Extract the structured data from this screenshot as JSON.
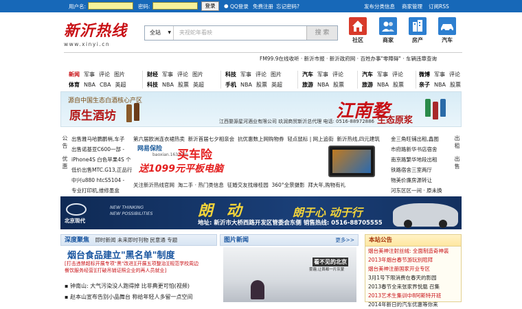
{
  "topbar": {
    "username_label": "用户名:",
    "password_label": "密码:",
    "login_button": "登录",
    "qq_login": "QQ登录",
    "register": "免费注册",
    "forgot": "忘记密码?",
    "right_links": [
      "发布分类信息",
      "商家管理",
      "订阅RSS"
    ]
  },
  "logo": {
    "title": "新沂热线",
    "url": "www.xinyi.cn"
  },
  "search": {
    "scope": "全站",
    "placeholder": "夹视蛇年看映",
    "button": "搜 索"
  },
  "categories": [
    {
      "label": "社区",
      "icon": "home-icon",
      "color": "#d83a2a"
    },
    {
      "label": "商家",
      "icon": "people-icon",
      "color": "#2d7fd0"
    },
    {
      "label": "房产",
      "icon": "building-icon",
      "color": "#2d7fd0"
    },
    {
      "label": "汽车",
      "icon": "car-icon",
      "color": "#2d7fd0"
    }
  ],
  "ticker": "FM99.9在线收听 · 新沂市报 · 新沂政府网 · 百姓办事\"零障碍\" · 车辆违章查询",
  "nav": [
    {
      "top": [
        "新闻",
        "军事",
        "评论",
        "图片"
      ],
      "bottom": [
        "体育",
        "NBA",
        "CBA",
        "英超"
      ]
    },
    {
      "top": [
        "财经",
        "军事",
        "评论",
        "图片"
      ],
      "bottom": [
        "科技",
        "NBA",
        "股票",
        "英超"
      ]
    },
    {
      "top": [
        "科技",
        "军事",
        "评论",
        "图片"
      ],
      "bottom": [
        "手机",
        "NBA",
        "股票",
        "英超"
      ]
    },
    {
      "top": [
        "汽车",
        "军事",
        "评论"
      ],
      "bottom": [
        "旅游",
        "NBA",
        "股票"
      ]
    },
    {
      "top": [
        "汽车",
        "军事",
        "评论"
      ],
      "bottom": [
        "旅游",
        "NBA",
        "股票"
      ]
    },
    {
      "top": [
        "微博",
        "军事",
        "评论"
      ],
      "bottom": [
        "亲子",
        "NBA",
        "股票"
      ]
    }
  ],
  "banner1": {
    "t1": "源自中国生态白酒核心产区",
    "t2": "原生酒坊",
    "t3": "江西婺源星河酒业有限公司 玖润商贸新沂总代理 电话: 0516-88972886",
    "t4": "江南婺",
    "t5": "生态原浆"
  },
  "mid": {
    "left_side": "公告",
    "left_side2": "优惠",
    "right_side": "出租",
    "right_side2": "出售",
    "col1": [
      "出售雅马哈鹏鹏梢,车子",
      "出售诺基亚C600一部 -",
      "iPhone4S 白色苹果4S 个",
      "低价出售MTC.G13,正品行",
      "中兴u880 htcS5104 -",
      "专业打印机,维修墨盒"
    ],
    "col2": [
      "第六届欧洲连衣裙热卖",
      "新沂首届七夕相亲会",
      "抗优惠数上网购物券",
      "轻点鼠标 | 网上追街",
      "新沂热线,四元建筑",
      "关注新沂热线官网",
      "淘二手 · 热门类信息",
      "征婚交友找缘桂园",
      "360°全景摄影",
      "拜大年,购物有礼"
    ],
    "col3": [
      "金三角旺铺出租,鑫图",
      "市府路新华书店宿舍",
      "南京路繁华地段出租",
      "铁路宿舍三室两厅",
      "物美价廉房源转让",
      "河东区区一间 · 原未换"
    ],
    "insurance": {
      "brand": "网易保险",
      "sub": "baoxian.163.com",
      "title": "买车险",
      "promo": "送1099元平板电脑"
    }
  },
  "banner2": {
    "brand": "北京现代",
    "slogan1": "NEW THINKING",
    "slogan2": "NEW POSSIBILITIES",
    "headline": "朗 动",
    "headline2": "朗于心 动于行",
    "address": "地址: 新沂市大桥西路开发区管委会东侧  销售热线: 0516-88705555"
  },
  "deep": {
    "title": "深度聚焦",
    "tabs": "即时新闻 未来即时刊物 民意通 专题",
    "headline": "烟台食品建立\"黑名单\"制度",
    "sub1": "[打击违禁超标开展专项\"黑\"改进][开展五项整治][规范学校周边",
    "sub2": "餐饮服务经营][打破吊销证照企业的再人员就业]",
    "lines": [
      "▪ 钟南山: 大气污染没人跑得掉 比非典更可怕(视频)",
      "▪ 赵本山宣布告别小品舞台 称给年轻人多留一点空间"
    ]
  },
  "photos": {
    "title": "图片新闻",
    "more": "更多>>",
    "caption": "看不见的北京",
    "caption2": "雾霾,让首都一片灰蒙"
  },
  "notice": {
    "title": "本站公告",
    "items": [
      "烟台美神注射丝绒: 全面制造奇神装",
      "2013年烟台春节游玩別陪拜",
      "烟台美神注册国家开业专区",
      "3月1号下限消费在春天的影园",
      "2013春节全来张家界悦凰 召集",
      "2013艺术生集训中8阿斯特开班",
      "2014年新日的汽车优惠等你来"
    ]
  }
}
